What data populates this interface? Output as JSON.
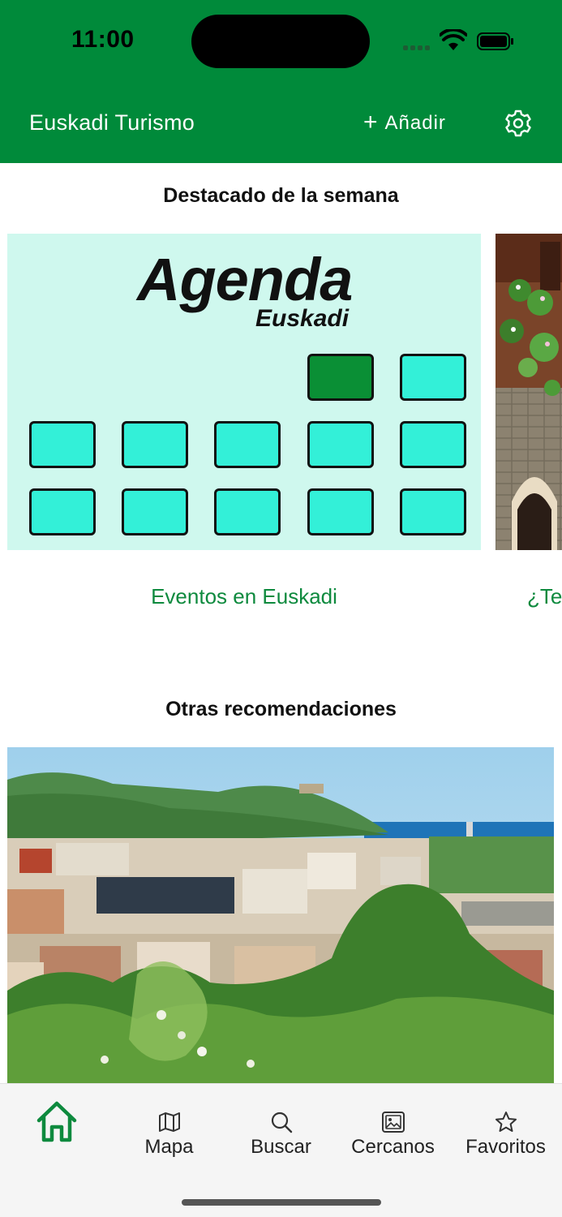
{
  "status_bar": {
    "time": "11:00"
  },
  "header": {
    "title": "Euskadi Turismo",
    "add_label": "Añadir",
    "settings_icon": "gear-icon",
    "background": "#008a3a"
  },
  "featured": {
    "title": "Destacado de la semana",
    "cards": [
      {
        "image_text": "Agenda",
        "image_subtext": "Euskadi",
        "caption": "Eventos en Euskadi"
      },
      {
        "caption": "¿Te"
      }
    ]
  },
  "others": {
    "title": "Otras recomendaciones"
  },
  "tabbar": {
    "tabs": [
      {
        "label": "",
        "icon": "home-icon",
        "active": true
      },
      {
        "label": "Mapa",
        "icon": "map-icon",
        "active": false
      },
      {
        "label": "Buscar",
        "icon": "search-icon",
        "active": false
      },
      {
        "label": "Cercanos",
        "icon": "gallery-icon",
        "active": false
      },
      {
        "label": "Favoritos",
        "icon": "star-icon",
        "active": false
      }
    ],
    "active_color": "#0e8a3e"
  }
}
